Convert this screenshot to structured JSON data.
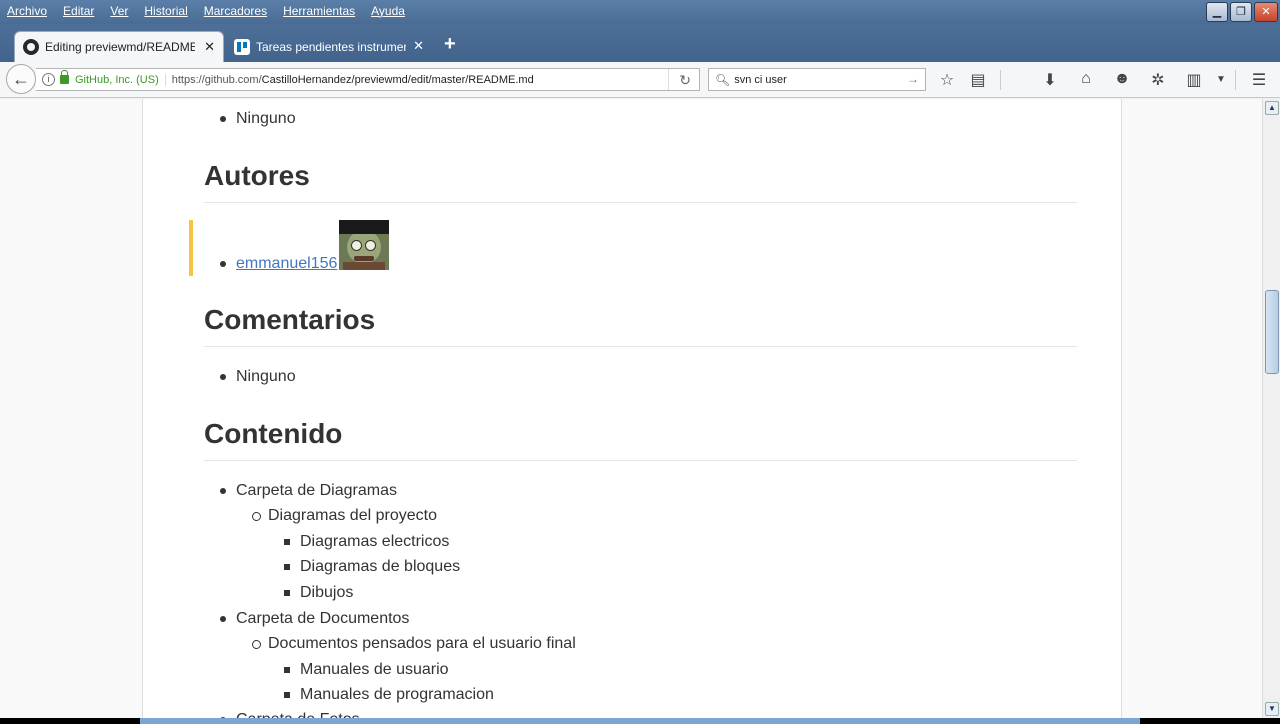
{
  "menubar": {
    "items": [
      "Archivo",
      "Editar",
      "Ver",
      "Historial",
      "Marcadores",
      "Herramientas",
      "Ayuda"
    ]
  },
  "window": {
    "minimize": "▁",
    "restore": "❐",
    "close": "✕"
  },
  "tabs": [
    {
      "title": "Editing previewmd/README....",
      "close": "✕"
    },
    {
      "title": "Tareas pendientes instrument...",
      "close": "✕"
    }
  ],
  "newtab": "+",
  "navbar": {
    "back": "←",
    "identity": "GitHub, Inc. (US)",
    "url_prefix": "https://github.com/",
    "url_rest": "CastilloHernandez/previewmd/edit/master/README.md",
    "reload": "↻",
    "search_value": "svn ci user",
    "search_go": "→"
  },
  "toolbar_icons": [
    "bookmark-star-icon",
    "reading-list-icon",
    "download-icon",
    "home-icon",
    "smiley-icon",
    "puzzle-icon",
    "clipboard-icon",
    "dropdown-icon",
    "menu-icon"
  ],
  "content": {
    "prev_item": "Ninguno",
    "authors_heading": "Autores",
    "author_link": "emmanuel156",
    "comments_heading": "Comentarios",
    "comments_item": "Ninguno",
    "contents_heading": "Contenido",
    "tree": [
      {
        "level": 1,
        "text": "Carpeta de Diagramas"
      },
      {
        "level": 2,
        "text": "Diagramas del proyecto"
      },
      {
        "level": 3,
        "text": "Diagramas electricos"
      },
      {
        "level": 3,
        "text": "Diagramas de bloques"
      },
      {
        "level": 3,
        "text": "Dibujos"
      },
      {
        "level": 1,
        "text": "Carpeta de Documentos"
      },
      {
        "level": 2,
        "text": "Documentos pensados para el usuario final"
      },
      {
        "level": 3,
        "text": "Manuales de usuario"
      },
      {
        "level": 3,
        "text": "Manuales de programacion"
      },
      {
        "level": 1,
        "text": "Carpeta de Fotos"
      }
    ]
  }
}
